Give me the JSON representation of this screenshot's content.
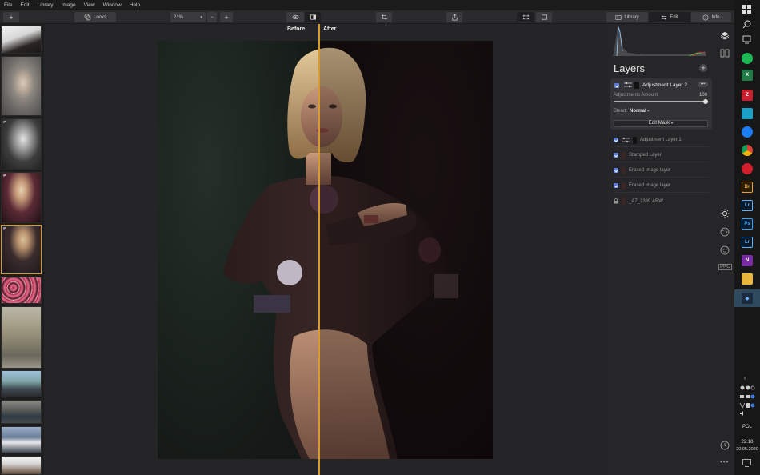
{
  "menu": [
    "File",
    "Edit",
    "Library",
    "Image",
    "View",
    "Window",
    "Help"
  ],
  "toolbar": {
    "add": "+",
    "looks": "Looks",
    "zoom": "21%",
    "zoom_out": "−",
    "zoom_in": "+",
    "tab_library": "Library",
    "tab_edit": "Edit",
    "tab_info": "Info"
  },
  "canvas": {
    "before": "Before",
    "after": "After"
  },
  "layers": {
    "title": "Layers",
    "add": "+",
    "active": {
      "name": "Adjustment Layer 2",
      "more": "•••",
      "amount_label": "Adjustments Amount",
      "amount_value": "100",
      "blend_label": "Blend:",
      "blend_value": "Normal",
      "mask_button": "Edit Mask"
    },
    "items": [
      {
        "name": "Adjustment Layer 1"
      },
      {
        "name": "Stamped Layer"
      },
      {
        "name": "Erased Image layer"
      },
      {
        "name": "Erased Image layer"
      },
      {
        "name": "_A7_2389.ARW"
      }
    ]
  },
  "side_tools": {
    "pro": "PRO"
  },
  "taskbar": {
    "apps": [
      "X",
      "Z",
      "Ps",
      "Lr",
      "Lr",
      "N",
      "Br"
    ],
    "lang": "POL",
    "time": "22:18",
    "date": "20.05.2020"
  },
  "colors": {
    "accent": "#d99b2b",
    "checkbox": "#5b7bd5"
  }
}
